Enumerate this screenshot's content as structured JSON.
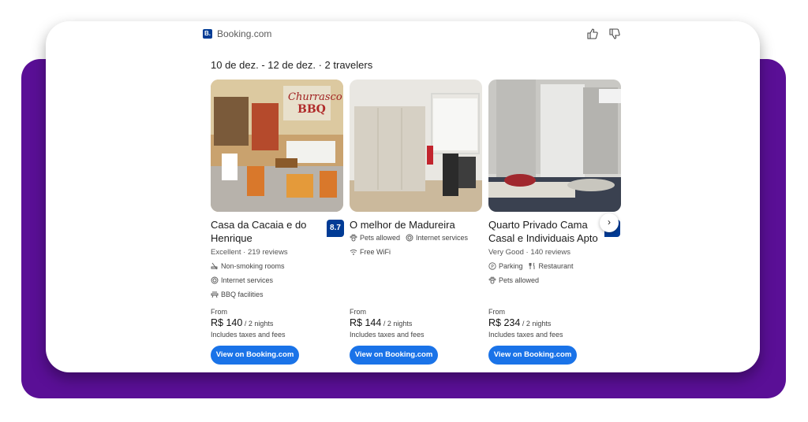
{
  "header": {
    "brand": "Booking.com",
    "logo_text": "B."
  },
  "search": {
    "dates_travelers": "10 de dez. - 12 de dez. · 2 travelers"
  },
  "hotels": [
    {
      "name": "Casa da Cacaia e do Henrique",
      "score": "8.7",
      "rating_text": "Excellent · 219 reviews",
      "amenities": [
        "Non-smoking rooms",
        "Internet services",
        "BBQ facilities"
      ],
      "from_label": "From",
      "price": "R$ 140",
      "nights": " / 2 nights",
      "taxes": "Includes taxes and fees",
      "button": "View on Booking.com"
    },
    {
      "name": "O melhor de Madureira",
      "score": "",
      "rating_text": "",
      "amenities": [
        "Pets allowed",
        "Internet services",
        "Free WiFi"
      ],
      "from_label": "From",
      "price": "R$ 144",
      "nights": " / 2 nights",
      "taxes": "Includes taxes and fees",
      "button": "View on Booking.com"
    },
    {
      "name": "Quarto Privado Cama Casal e Individuais Apto",
      "score": "",
      "rating_text": "Very Good · 140 reviews",
      "amenities": [
        "Parking",
        "Restaurant",
        "Pets allowed"
      ],
      "from_label": "From",
      "price": "R$ 234",
      "nights": " / 2 nights",
      "taxes": "Includes taxes and fees",
      "button": "View on Booking.com"
    }
  ],
  "carousel": {
    "next_icon": "chevron-right-icon"
  },
  "colors": {
    "brand_blue": "#003b95",
    "button_blue": "#1a73e8",
    "backdrop_purple": "#5a0f96"
  }
}
